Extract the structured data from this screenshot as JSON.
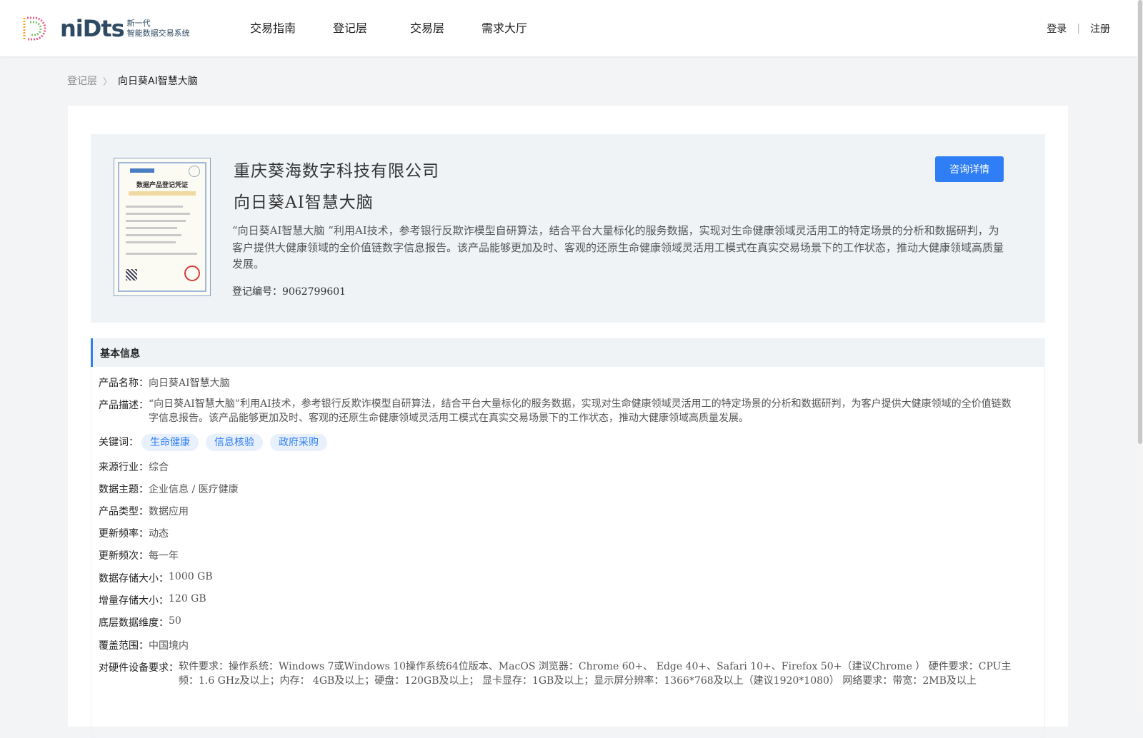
{
  "header": {
    "logo_word": "niDts",
    "logo_sub_line1": "新一代",
    "logo_sub_line2": "智能数据交易系统",
    "nav": [
      "交易指南",
      "登记层",
      "交易层",
      "需求大厅"
    ],
    "login": "登录",
    "separator": "|",
    "register": "注册"
  },
  "breadcrumb": {
    "parent": "登记层",
    "separator": "〉",
    "current": "向日葵AI智慧大脑"
  },
  "hero": {
    "company": "重庆葵海数字科技有限公司",
    "product": "向日葵AI智慧大脑",
    "description": "“向日葵AI智慧大脑 ”利用AI技术，参考银行反欺诈模型自研算法，结合平台大量标化的服务数据，实现对生命健康领域灵活用工的特定场景的分析和数据研判，为客户提供大健康领域的全价值链数字信息报告。该产品能够更加及时、客观的还原生命健康领域灵活用工模式在真实交易场景下的工作状态，推动大健康领域高质量发展。",
    "reg_label": "登记编号：",
    "reg_number": "9062799601",
    "consult_button": "咨询详情",
    "certificate_title": "数据产品登记凭证"
  },
  "basic_info": {
    "title": "基本信息",
    "product_name_label": "产品名称：",
    "product_name": "向日葵AI智慧大脑",
    "product_desc_label": "产品描述：",
    "product_desc": "“向日葵AI智慧大脑”利用AI技术，参考银行反欺诈模型自研算法，结合平台大量标化的服务数据，实现对生命健康领域灵活用工的特定场景的分析和数据研判，为客户提供大健康领域的全价值链数字信息报告。该产品能够更加及时、客观的还原生命健康领域灵活用工模式在真实交易场景下的工作状态，推动大健康领域高质量发展。",
    "keywords_label": "关键词：",
    "keywords": [
      "生命健康",
      "信息核验",
      "政府采购"
    ],
    "industry_label": "来源行业：",
    "industry": "综合",
    "topic_label": "数据主题：",
    "topic": "企业信息 / 医疗健康",
    "type_label": "产品类型：",
    "type": "数据应用",
    "freq_label": "更新频率：",
    "freq": "动态",
    "cycle_label": "更新频次：",
    "cycle": "每一年",
    "storage_label": "数据存储大小：",
    "storage": "1000 GB",
    "increment_label": "增量存储大小：",
    "increment": "120 GB",
    "dimension_label": "底层数据维度：",
    "dimension": "50",
    "coverage_label": "覆盖范围：",
    "coverage": "中国境内",
    "hardware_label": "对硬件设备要求：",
    "hardware": "软件要求：操作系统：Windows 7或Windows 10操作系统64位版本、MacOS 浏览器：Chrome 60+、 Edge 40+、Safari 10+、Firefox 50+（建议Chrome ） 硬件要求：CPU主频：1.6 GHz及以上；内存： 4GB及以上；硬盘：120GB及以上； 显卡显存：1GB及以上；显示屏分辨率：1366*768及以上（建议1920*1080） 网络要求：带宽：2MB及以上"
  },
  "colors": {
    "accent": "#2f7ef5",
    "hero_bg": "#eff3f6",
    "page_bg": "#f3f4f6"
  }
}
